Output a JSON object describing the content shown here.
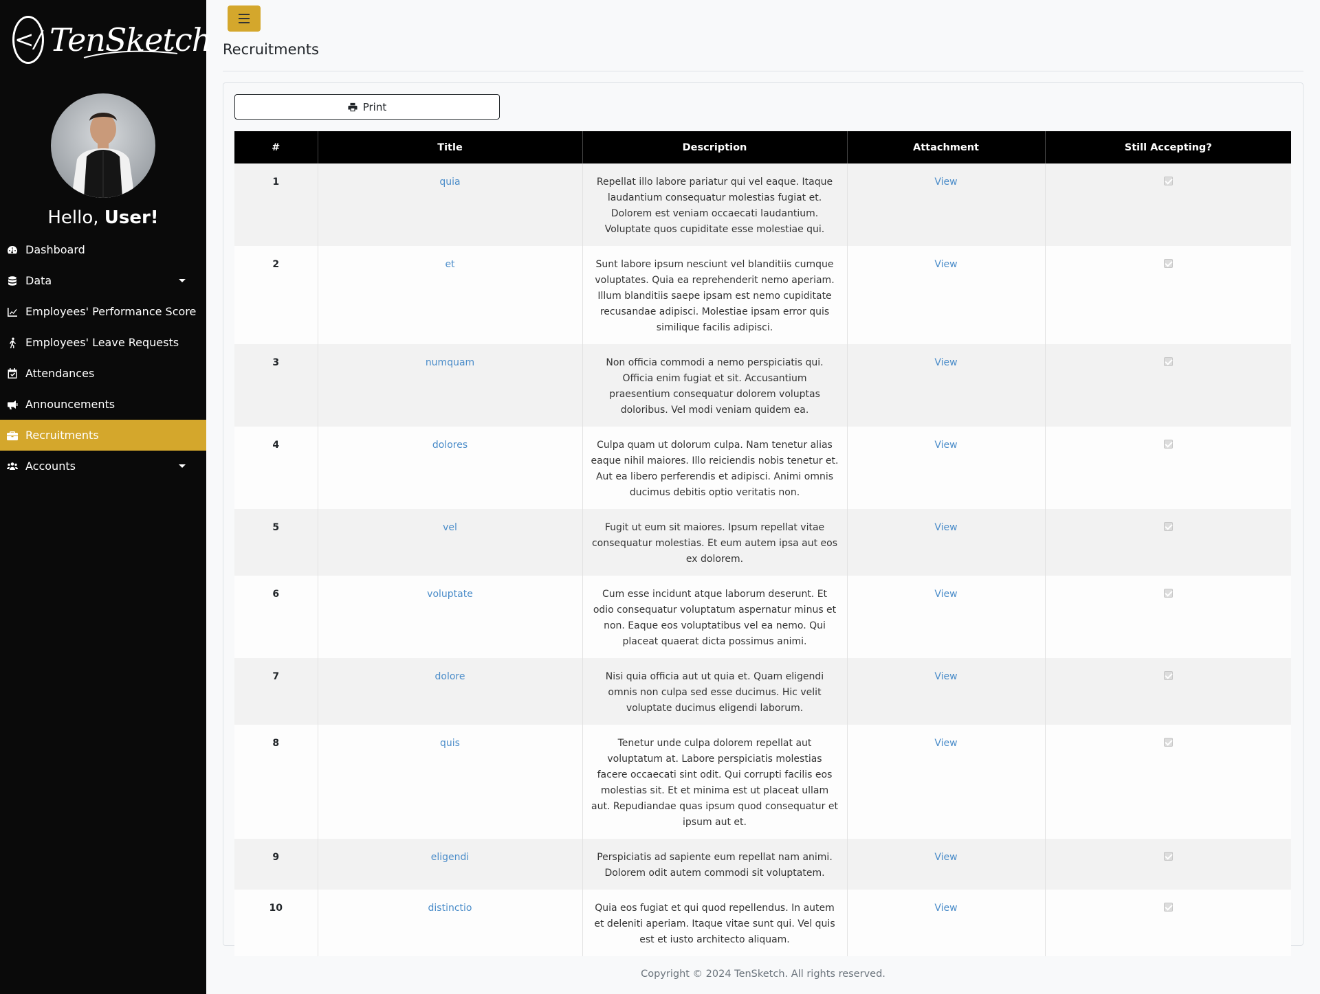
{
  "brand": {
    "name": "TenSketch",
    "mark": "</"
  },
  "greeting": {
    "prefix": "Hello,",
    "name": "User!"
  },
  "nav": [
    {
      "label": "Dashboard",
      "icon": "gauge-icon",
      "active": false,
      "dropdown": false
    },
    {
      "label": "Data",
      "icon": "database-icon",
      "active": false,
      "dropdown": true
    },
    {
      "label": "Employees' Performance Score",
      "icon": "chart-line-icon",
      "active": false,
      "dropdown": false
    },
    {
      "label": "Employees' Leave Requests",
      "icon": "person-walking-icon",
      "active": false,
      "dropdown": false
    },
    {
      "label": "Attendances",
      "icon": "calendar-check-icon",
      "active": false,
      "dropdown": false
    },
    {
      "label": "Announcements",
      "icon": "bullhorn-icon",
      "active": false,
      "dropdown": false
    },
    {
      "label": "Recruitments",
      "icon": "briefcase-icon",
      "active": true,
      "dropdown": false
    },
    {
      "label": "Accounts",
      "icon": "users-icon",
      "active": false,
      "dropdown": true
    }
  ],
  "accent_color": "#d4a72c",
  "page_title": "Recruitments",
  "print_label": "Print",
  "table": {
    "headers": [
      "#",
      "Title",
      "Description",
      "Attachment",
      "Still Accepting?"
    ],
    "rows": [
      {
        "num": "1",
        "title": "quia",
        "description": "Repellat illo labore pariatur qui vel eaque. Itaque laudantium consequatur molestias fugiat et. Dolorem est veniam occaecati laudantium. Voluptate quos cupiditate esse molestiae qui.",
        "attachment": "View",
        "accepting": true
      },
      {
        "num": "2",
        "title": "et",
        "description": "Sunt labore ipsum nesciunt vel blanditiis cumque voluptates. Quia ea reprehenderit nemo aperiam. Illum blanditiis saepe ipsam est nemo cupiditate recusandae adipisci. Molestiae ipsam error quis similique facilis adipisci.",
        "attachment": "View",
        "accepting": true
      },
      {
        "num": "3",
        "title": "numquam",
        "description": "Non officia commodi a nemo perspiciatis qui. Officia enim fugiat et sit. Accusantium praesentium consequatur dolorem voluptas doloribus. Vel modi veniam quidem ea.",
        "attachment": "View",
        "accepting": true
      },
      {
        "num": "4",
        "title": "dolores",
        "description": "Culpa quam ut dolorum culpa. Nam tenetur alias eaque nihil maiores. Illo reiciendis nobis tenetur et. Aut ea libero perferendis et adipisci. Animi omnis ducimus debitis optio veritatis non.",
        "attachment": "View",
        "accepting": true
      },
      {
        "num": "5",
        "title": "vel",
        "description": "Fugit ut eum sit maiores. Ipsum repellat vitae consequatur molestias. Et eum autem ipsa aut eos ex dolorem.",
        "attachment": "View",
        "accepting": true
      },
      {
        "num": "6",
        "title": "voluptate",
        "description": "Cum esse incidunt atque laborum deserunt. Et odio consequatur voluptatum aspernatur minus et non. Eaque eos voluptatibus vel ea nemo. Qui placeat quaerat dicta possimus animi.",
        "attachment": "View",
        "accepting": true
      },
      {
        "num": "7",
        "title": "dolore",
        "description": "Nisi quia officia aut ut quia et. Quam eligendi omnis non culpa sed esse ducimus. Hic velit voluptate ducimus eligendi laborum.",
        "attachment": "View",
        "accepting": true
      },
      {
        "num": "8",
        "title": "quis",
        "description": "Tenetur unde culpa dolorem repellat aut voluptatum at. Labore perspiciatis molestias facere occaecati sint odit. Qui corrupti facilis eos molestias sit. Et et minima est ut placeat ullam aut. Repudiandae quas ipsum quod consequatur et ipsum aut et.",
        "attachment": "View",
        "accepting": true
      },
      {
        "num": "9",
        "title": "eligendi",
        "description": "Perspiciatis ad sapiente eum repellat nam animi. Dolorem odit autem commodi sit voluptatem.",
        "attachment": "View",
        "accepting": true
      },
      {
        "num": "10",
        "title": "distinctio",
        "description": "Quia eos fugiat et qui quod repellendus. In autem et deleniti aperiam. Itaque vitae sunt qui. Vel quis est et iusto architecto aliquam.",
        "attachment": "View",
        "accepting": true
      }
    ]
  },
  "footer": "Copyright © 2024 TenSketch. All rights reserved."
}
